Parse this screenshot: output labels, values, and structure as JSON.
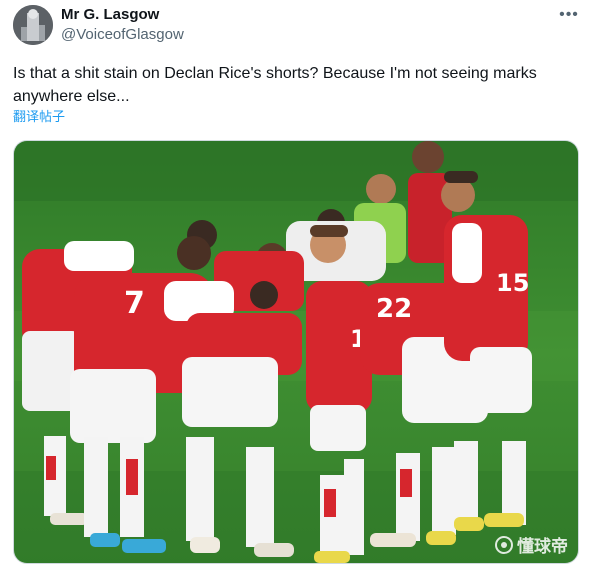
{
  "author": {
    "display_name": "Mr G. Lasgow",
    "handle": "@VoiceofGlasgow",
    "avatar_icon": "avatar-photo"
  },
  "menu": {
    "more_label": "•••"
  },
  "tweet": {
    "text": "Is that a shit stain on Declan Rice's shorts? Because I'm not seeing marks anywhere else...",
    "translate_label": "翻译帖子"
  },
  "media": {
    "players": [
      {
        "number": "7"
      },
      {
        "number": "19"
      },
      {
        "number": "22"
      },
      {
        "number": "15"
      }
    ],
    "watermark_text": "懂球帝"
  },
  "colors": {
    "pitch": "#3f8a2e",
    "shirt_red": "#d6262d",
    "accent_link": "#1d9bf0",
    "keeper_green": "#8fd14f"
  }
}
